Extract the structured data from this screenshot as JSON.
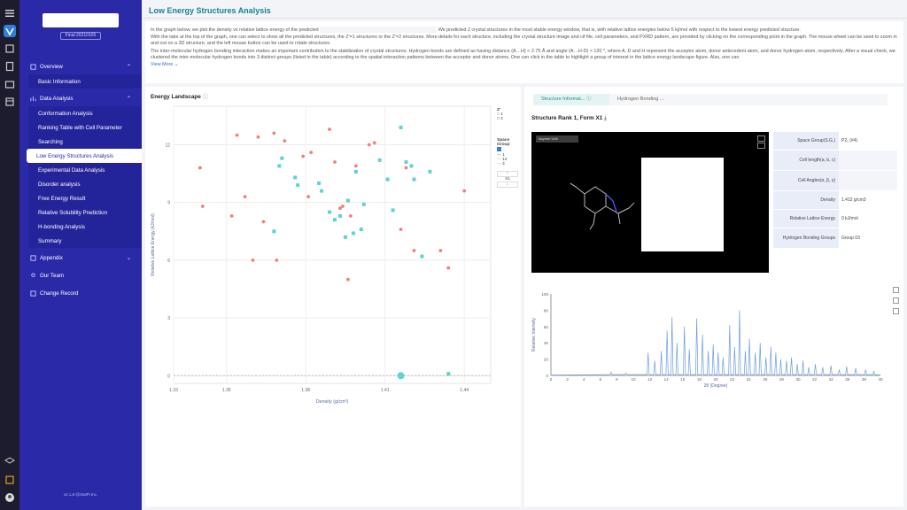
{
  "sidebar": {
    "version_label": "Final 20210105",
    "footer": "v2.1.8  @XtalPi Inc.",
    "sections": [
      {
        "label": "Overview",
        "items": [
          "Basic Information"
        ]
      },
      {
        "label": "Data Analysis",
        "items": [
          "Conformation Analysis",
          "Ranking Table with Cell Parameter",
          "Searching",
          "Low Energy Structures Analysis",
          "Experimental Data Analysis",
          "Disorder analysis",
          "Free Energy Result",
          "Relative Solubility Prediction",
          "H-bonding Analysis",
          "Summary"
        ]
      },
      {
        "label": "Appendix",
        "items": []
      },
      {
        "label": "Our Team",
        "items": []
      },
      {
        "label": "Change Record",
        "items": []
      }
    ],
    "active_item": "Low Energy Structures Analysis"
  },
  "page": {
    "title": "Low Energy Structures Analysis",
    "description": {
      "p1_before": "In the graph below, we plot the density vs relative lattice energy of the predicted",
      "p1_after": "We predicted 2 crystal structures in the most stable energy window, that is, with relative lattice energies below 5 kj/mol with respect to the lowest energy predicted structure.",
      "p2": "With the tabs at the top of the graph, one can select to show all the predicted structures, the Z'=1 structures or the Z'=2 structures. More details for each structure, including the crystal structure image and cif file, cell parameters, and PXRD pattern, are provided by clicking on the corresponding point in the graph. The mouse wheel can be used to zoom in and out on a 3D structure, and the left mouse button can be used to rotate structures.",
      "p3": "The inter-molecular hydrogen bonding interaction makes an important contribution to the stabilization of crystal structures. Hydrogen bonds are defined as having distance (A…H) < 2.75 Å and angle (A…H-D) > 120 °, where A, D and H represent the acceptor atom, donor antecedent atom, and donor hydrogen atom, respectively. After a visual check, we clustered the inter-molecular hydrogen bonds into 3 distinct groups (listed in the table) according to the spatial interaction patterns between the acceptor and donor atoms. One can click in the table to highlight a group of interest in the lattice energy landscape figure. Also, one can",
      "view_more": "View More"
    }
  },
  "energy_landscape": {
    "title": "Energy Landscape",
    "legend_z_title": "Z'",
    "legend_z": [
      "1",
      "2"
    ],
    "legend_sg_title": "Space Group",
    "legend_sg": [
      "1",
      "14",
      "4"
    ],
    "zoom_label": "X1",
    "colors": {
      "sg1": "#f08080",
      "sg4": "#5fd3d0"
    }
  },
  "chart_data": {
    "type": "scatter",
    "xlabel": "Density (g/cm³)",
    "ylabel": "Relative Lattice Energy (kJ/mol)",
    "xlim": [
      1.33,
      1.45
    ],
    "ylim": [
      -0.4,
      14.0
    ],
    "x_ticks": [
      "1.33",
      "1.35",
      "1.38",
      "1.41",
      "1.44"
    ],
    "x_tick_values": [
      1.33,
      1.35,
      1.38,
      1.41,
      1.44
    ],
    "y_ticks": [
      "0",
      "3",
      "6",
      "9",
      "12"
    ],
    "y_tick_values": [
      0,
      3,
      6,
      9,
      12
    ],
    "series": [
      {
        "name": "1",
        "marker": "circle",
        "color": "#f08080",
        "points": [
          [
            1.34,
            10.8
          ],
          [
            1.341,
            8.8
          ],
          [
            1.352,
            8.3
          ],
          [
            1.354,
            12.5
          ],
          [
            1.357,
            9.3
          ],
          [
            1.36,
            6.0
          ],
          [
            1.362,
            12.4
          ],
          [
            1.364,
            8.0
          ],
          [
            1.368,
            12.6
          ],
          [
            1.369,
            6.0
          ],
          [
            1.372,
            12.2
          ],
          [
            1.379,
            11.4
          ],
          [
            1.381,
            9.3
          ],
          [
            1.382,
            11.6
          ],
          [
            1.389,
            12.8
          ],
          [
            1.391,
            11.1
          ],
          [
            1.393,
            8.7
          ],
          [
            1.394,
            8.8
          ],
          [
            1.396,
            5.0
          ],
          [
            1.397,
            8.3
          ],
          [
            1.399,
            10.9
          ],
          [
            1.404,
            12.0
          ],
          [
            1.406,
            12.1
          ],
          [
            1.416,
            7.6
          ],
          [
            1.418,
            10.8
          ],
          [
            1.421,
            6.5
          ],
          [
            1.431,
            6.5
          ],
          [
            1.434,
            5.6
          ],
          [
            1.44,
            9.6
          ]
        ]
      },
      {
        "name": "4",
        "marker": "square",
        "color": "#5fd3d0",
        "points": [
          [
            1.368,
            7.5
          ],
          [
            1.37,
            10.9
          ],
          [
            1.371,
            11.3
          ],
          [
            1.376,
            10.3
          ],
          [
            1.377,
            9.9
          ],
          [
            1.385,
            10.0
          ],
          [
            1.386,
            9.6
          ],
          [
            1.389,
            8.5
          ],
          [
            1.391,
            8.1
          ],
          [
            1.393,
            8.3
          ],
          [
            1.395,
            7.2
          ],
          [
            1.396,
            9.1
          ],
          [
            1.398,
            7.4
          ],
          [
            1.399,
            10.6
          ],
          [
            1.401,
            7.6
          ],
          [
            1.402,
            8.9
          ],
          [
            1.408,
            11.2
          ],
          [
            1.411,
            10.2
          ],
          [
            1.413,
            8.6
          ],
          [
            1.416,
            12.9
          ],
          [
            1.418,
            11.1
          ],
          [
            1.42,
            10.9
          ],
          [
            1.421,
            10.2
          ],
          [
            1.424,
            6.2
          ],
          [
            1.427,
            10.6
          ],
          [
            1.416,
            0.0
          ],
          [
            1.434,
            0.1
          ]
        ]
      }
    ],
    "highlight_point": [
      1.416,
      0.0
    ]
  },
  "structure": {
    "tabs": [
      "Structure Informat...",
      "Hydrogen Bonding ..."
    ],
    "title": "Structure Rank 1, Form X1",
    "viewer_badge": "Asymm Unit",
    "properties": [
      {
        "key": "Space Group(S.G.)",
        "value": "P2₁ (#4)"
      },
      {
        "key": "Cell length(a, b, c)",
        "value": ""
      },
      {
        "key": "Cell Angles(α, β, γ)",
        "value": ""
      },
      {
        "key": "Density",
        "value": "1.412 g/cm3"
      },
      {
        "key": "Relative Lattice Energy",
        "value": "0 kJ/mol"
      },
      {
        "key": "Hydrogen Bonding Groups",
        "value": "Group 03"
      }
    ]
  },
  "pxrd": {
    "ylabel": "Relative Intensity",
    "xlabel": "2θ (Degree)",
    "y_ticks": [
      "0",
      "20",
      "40",
      "60",
      "80",
      "100"
    ],
    "x_ticks": [
      "0",
      "2",
      "4",
      "6",
      "8",
      "10",
      "12",
      "14",
      "16",
      "18",
      "20",
      "22",
      "24",
      "26",
      "28",
      "30",
      "32",
      "34",
      "36",
      "38",
      "40"
    ],
    "line_color": "#6e9be0",
    "peaks": [
      [
        7.3,
        4
      ],
      [
        9.1,
        3
      ],
      [
        11.8,
        28
      ],
      [
        12.6,
        18
      ],
      [
        13.4,
        30
      ],
      [
        14.1,
        55
      ],
      [
        14.7,
        72
      ],
      [
        15.3,
        40
      ],
      [
        16.2,
        60
      ],
      [
        16.8,
        32
      ],
      [
        17.7,
        70
      ],
      [
        18.4,
        50
      ],
      [
        19.1,
        30
      ],
      [
        19.7,
        38
      ],
      [
        20.3,
        28
      ],
      [
        20.9,
        22
      ],
      [
        21.7,
        62
      ],
      [
        22.3,
        35
      ],
      [
        22.9,
        80
      ],
      [
        23.6,
        30
      ],
      [
        24.1,
        45
      ],
      [
        24.8,
        28
      ],
      [
        25.4,
        40
      ],
      [
        26.1,
        22
      ],
      [
        26.7,
        35
      ],
      [
        27.3,
        28
      ],
      [
        27.9,
        20
      ],
      [
        28.6,
        18
      ],
      [
        29.2,
        22
      ],
      [
        29.9,
        14
      ],
      [
        30.6,
        18
      ],
      [
        31.3,
        10
      ],
      [
        32.1,
        14
      ],
      [
        33.0,
        10
      ],
      [
        34.0,
        12
      ],
      [
        35.0,
        7
      ],
      [
        35.9,
        11
      ],
      [
        37.0,
        9
      ],
      [
        38.2,
        7
      ],
      [
        39.2,
        5
      ]
    ]
  }
}
